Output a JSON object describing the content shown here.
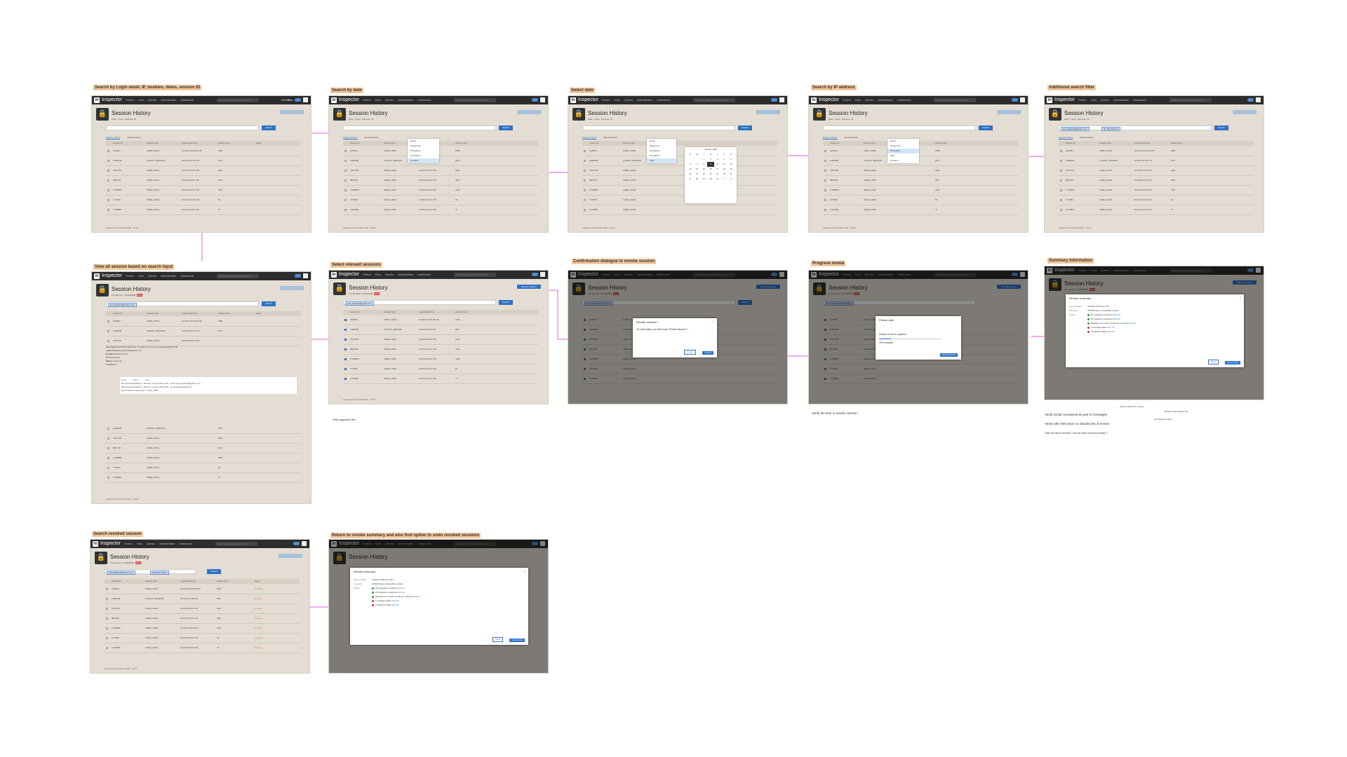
{
  "app": {
    "name": "Inspector",
    "nav_items": [
      "Finders",
      "Tools",
      "Queues",
      "Administration",
      "Dashboards"
    ],
    "search_placeholder": "Search by Name, Email, Phone #",
    "status": "I'm Offline"
  },
  "page": {
    "title": "Session History",
    "subtitle": "For Member: 1234568181",
    "badge": "8891",
    "revoke_button": "Revoke session",
    "search_button": "Search",
    "search_placeholder": "Search",
    "tabs": [
      "Session history",
      "Revoke history"
    ],
    "footer": "Inspector 10 Linkedin 2022 · Terms",
    "columns": [
      "Session ID",
      "Session Type",
      "Logout Date/Time",
      "Last Activity",
      "Activity count",
      "Flags"
    ]
  },
  "frames": [
    {
      "title": "Search by Login email, IP, bookies, dates, session ID"
    },
    {
      "title": "Search by date"
    },
    {
      "title": "Select date"
    },
    {
      "title": "Search by IP address"
    },
    {
      "title": "Additional search filter"
    },
    {
      "title": "View all session based on search input"
    },
    {
      "title": "Select relevant sessions"
    },
    {
      "title": "Confirmation dialogue to revoke session"
    },
    {
      "title": "Progress modal"
    },
    {
      "title": "Summary information"
    },
    {
      "title": "Search revoked session"
    },
    {
      "title": "Return to revoke summary and also find option to undo revoked sessions"
    }
  ],
  "table_rows": [
    {
      "id": "1234567",
      "type": "USER_LOGIN",
      "logout": "10.28.20 10:45:35 UTC",
      "last": "10.28.20 10:43 UTC",
      "count": "1560"
    },
    {
      "id": "11992948",
      "type": "LOGOUT_SESSION",
      "logout": "10.28.20 11:45 UTC",
      "last": "10.28.20 11:00 UTC",
      "count": "2572"
    },
    {
      "id": "37147761",
      "type": "USER_LOGIN",
      "logout": "",
      "last": "10.28.20 10:43 UTC",
      "count": "2232"
    },
    {
      "id": "8821738",
      "type": "USER_LOGIN",
      "logout": "",
      "last": "10.28.20 10:43 UTC",
      "count": "3421"
    },
    {
      "id": "17198950",
      "type": "USER_LOGIN",
      "logout": "",
      "last": "10.28.20 10:43 UTC",
      "count": "4422"
    },
    {
      "id": "7173681",
      "type": "USER_LOGIN",
      "logout": "",
      "last": "10.28.20 10:43 UTC",
      "count": "64"
    },
    {
      "id": "17139801",
      "type": "USER_LOGIN",
      "logout": "",
      "last": "10.28.20 10:43 UTC",
      "count": "71"
    }
  ],
  "filters": {
    "dates_label": "Date: 7 days",
    "browser_label": "Browser: All",
    "email_chip": "jane.goldsmith@yahoo.com",
    "ip_chip": "IP: 103.42.92.12",
    "revoked_chip": "Revoked session"
  },
  "search_dropdown": [
    "Email",
    "Session ID",
    "IP address",
    "IP address",
    "Date",
    "Location"
  ],
  "calendar": {
    "month": "January 2020",
    "days": [
      "S",
      "M",
      "T",
      "W",
      "T",
      "F",
      "S"
    ],
    "dates": [
      "",
      "",
      "1",
      "2",
      "3",
      "4",
      "5",
      "6",
      "7",
      "8",
      "9",
      "10",
      "11",
      "12",
      "13",
      "14",
      "15",
      "16",
      "17",
      "18",
      "19",
      "20",
      "21",
      "22",
      "23",
      "24",
      "25",
      "26",
      "27",
      "28",
      "29",
      "30",
      "31",
      "1",
      "2"
    ],
    "selected": "9",
    "clear": "Clear dates",
    "done": "Done"
  },
  "expanded": {
    "labels": [
      "User agent",
      "Login email",
      "IP address",
      "IP",
      "Binary",
      "Country"
    ],
    "values": [
      "Mozilla/5.0 (Macintosh; Intel Mac OS X 10_14_6) AppleWebKit/537.36",
      "jane.goldsmith@yahoo.com",
      "103.42.92.12",
      "103.42.92.12",
      "Android 10",
      "US"
    ],
    "events_header": [
      "Event",
      "Target",
      "Value"
    ],
    "events": [
      {
        "event": "Remove Email Address",
        "target": "Member: urn:li:member:1234",
        "value": "email: jane.goldsmith@yahoo.com"
      },
      {
        "event": "Remove Email Address",
        "target": "Member: urn:li:member:1234",
        "value": "email: janeg@gmail.com"
      },
      {
        "event": "New Invitation request sent",
        "target": "",
        "value": "Invitee: 3466"
      }
    ]
  },
  "confirm_modal": {
    "title": "Revoke session?",
    "body": "On confirmation, you will revoke 25 listed sessions ?",
    "cancel": "Cancel",
    "confirm": "Confirm"
  },
  "progress_modal": {
    "title": "Please wait...",
    "body": "Session revoke in progress",
    "status": "20% complete",
    "button": "Submit process"
  },
  "summary_modal": {
    "title": "Revoke summary",
    "labels": [
      "Action initiated",
      "Summary",
      "Details"
    ],
    "initiated": "4/2/2021 3:58:24 pm IST",
    "summary": "3/5/2038 were successfully revoked",
    "details": [
      {
        "text": "25 messages considered",
        "link": "View list",
        "color": "#2e9b3c"
      },
      {
        "text": "25 invitations considered",
        "link": "View list",
        "color": "#2e9b3c"
      },
      {
        "text": "Marketed 4 of a spam results are reviewed",
        "link": "View list",
        "color": "#2e9b3c"
      },
      {
        "text": "2 messages failed",
        "link": "View list",
        "color": "#d33333"
      },
      {
        "text": "4 invitations failed",
        "link": "View list",
        "color": "#d33333"
      }
    ],
    "close": "Close",
    "undo": "Undo revoke"
  },
  "revoked_label": "Revoked",
  "notes": {
    "pagination": "Verify pagination limit",
    "time": "Verify the time to revoke session",
    "inmail": "Verify inmail considered as part of messages",
    "ams": "Verify with AMS team on detailed list of events",
    "undo_question": "How the list is formed? can we view event summary ?",
    "small1": "Session started for recovery",
    "small2": "Browse safety with (10 vis)",
    "small3": "Are revoked by them"
  },
  "colors": {
    "accent": "#2f72c4",
    "nav_bg": "#2c2c2c",
    "frame_bg": "#e3ddd3",
    "connector": "#d95fd6",
    "title_bg": "#f2c89b",
    "badge": "#d33333",
    "revoked": "#e67e22"
  }
}
